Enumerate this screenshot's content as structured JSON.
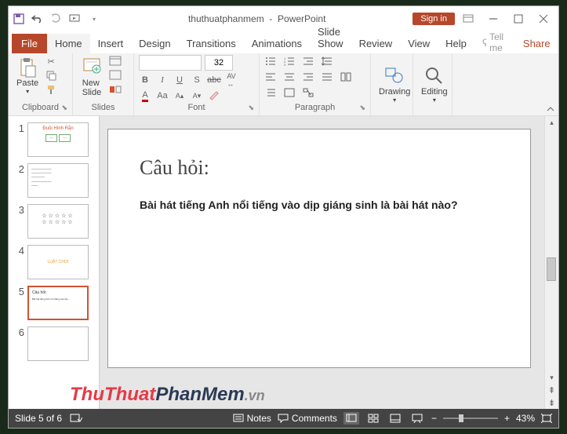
{
  "titlebar": {
    "doc_name": "thuthuatphanmem",
    "app_name": "PowerPoint",
    "signin": "Sign in"
  },
  "tabs": {
    "file": "File",
    "items": [
      "Home",
      "Insert",
      "Design",
      "Transitions",
      "Animations",
      "Slide Show",
      "Review",
      "View",
      "Help"
    ],
    "tellme": "Tell me",
    "share": "Share"
  },
  "ribbon": {
    "clipboard": {
      "paste": "Paste",
      "label": "Clipboard"
    },
    "slides": {
      "new_slide": "New\nSlide",
      "label": "Slides"
    },
    "font": {
      "size": "32",
      "label": "Font"
    },
    "paragraph": {
      "label": "Paragraph"
    },
    "drawing": {
      "btn": "Drawing",
      "label": ""
    },
    "editing": {
      "btn": "Editing",
      "label": ""
    }
  },
  "thumbs": [
    {
      "n": "1",
      "sel": false
    },
    {
      "n": "2",
      "sel": false
    },
    {
      "n": "3",
      "sel": false
    },
    {
      "n": "4",
      "sel": false
    },
    {
      "n": "5",
      "sel": true
    },
    {
      "n": "6",
      "sel": false
    }
  ],
  "slide": {
    "title": "Câu hỏi:",
    "body": "Bài hát tiếng Anh nổi tiếng vào dịp giáng sinh là bài hát nào?"
  },
  "status": {
    "slide_info": "Slide 5 of 6",
    "notes": "Notes",
    "comments": "Comments",
    "zoom": "43%"
  },
  "watermark": {
    "a": "ThuThuat",
    "b": "PhanMem",
    "c": ".vn"
  }
}
